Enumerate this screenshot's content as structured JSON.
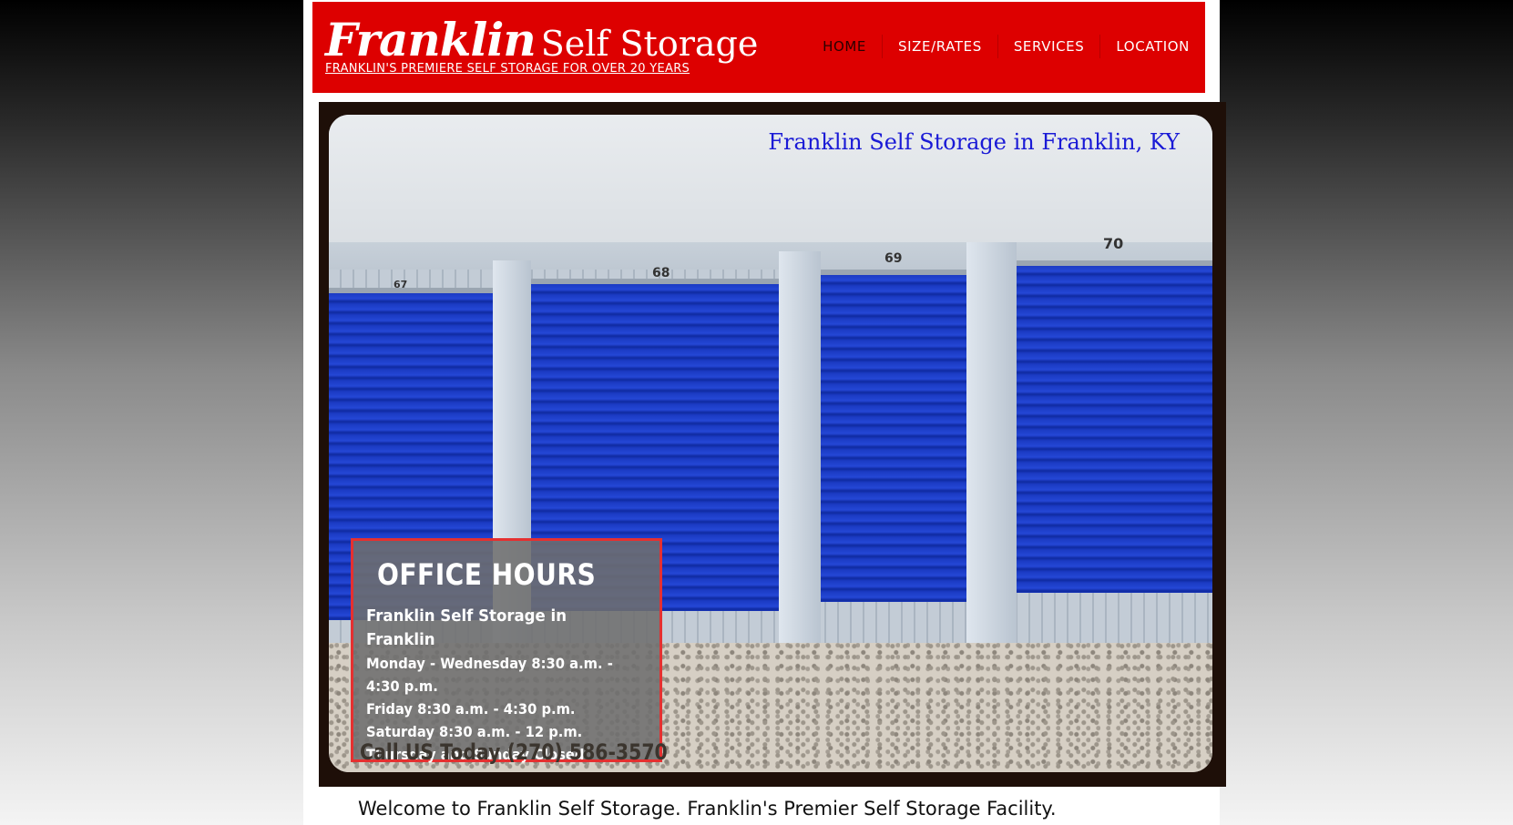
{
  "header": {
    "logo_script": "Franklin",
    "logo_main": "Self Storage",
    "tagline": "FRANKLIN'S PREMIERE SELF STORAGE FOR OVER 20 YEARS",
    "nav": [
      "HOME",
      "SIZE/RATES",
      "SERVICES",
      "LOCATION"
    ]
  },
  "hero": {
    "title": "Franklin Self Storage in Franklin, KY",
    "door_numbers": [
      "67",
      "68",
      "69",
      "70"
    ],
    "office_hours": {
      "heading": "OFFICE HOURS",
      "subtitle": "Franklin Self Storage in Franklin",
      "lines": [
        "Monday - Wednesday 8:30 a.m. - 4:30 p.m.",
        "Friday 8:30 a.m. - 4:30 p.m.",
        "Saturday 8:30 a.m. - 12 p.m.",
        "Thursday and Sunday Closed"
      ],
      "call": "Call US Today (270) 586-3570"
    }
  },
  "main": {
    "welcome": "Welcome to Franklin Self Storage. Franklin's Premier Self Storage Facility."
  },
  "colors": {
    "header_red": "#dd0000",
    "door_blue": "#1b3bc4",
    "hero_title": "#1a1ad6",
    "hours_border": "#e53030"
  }
}
